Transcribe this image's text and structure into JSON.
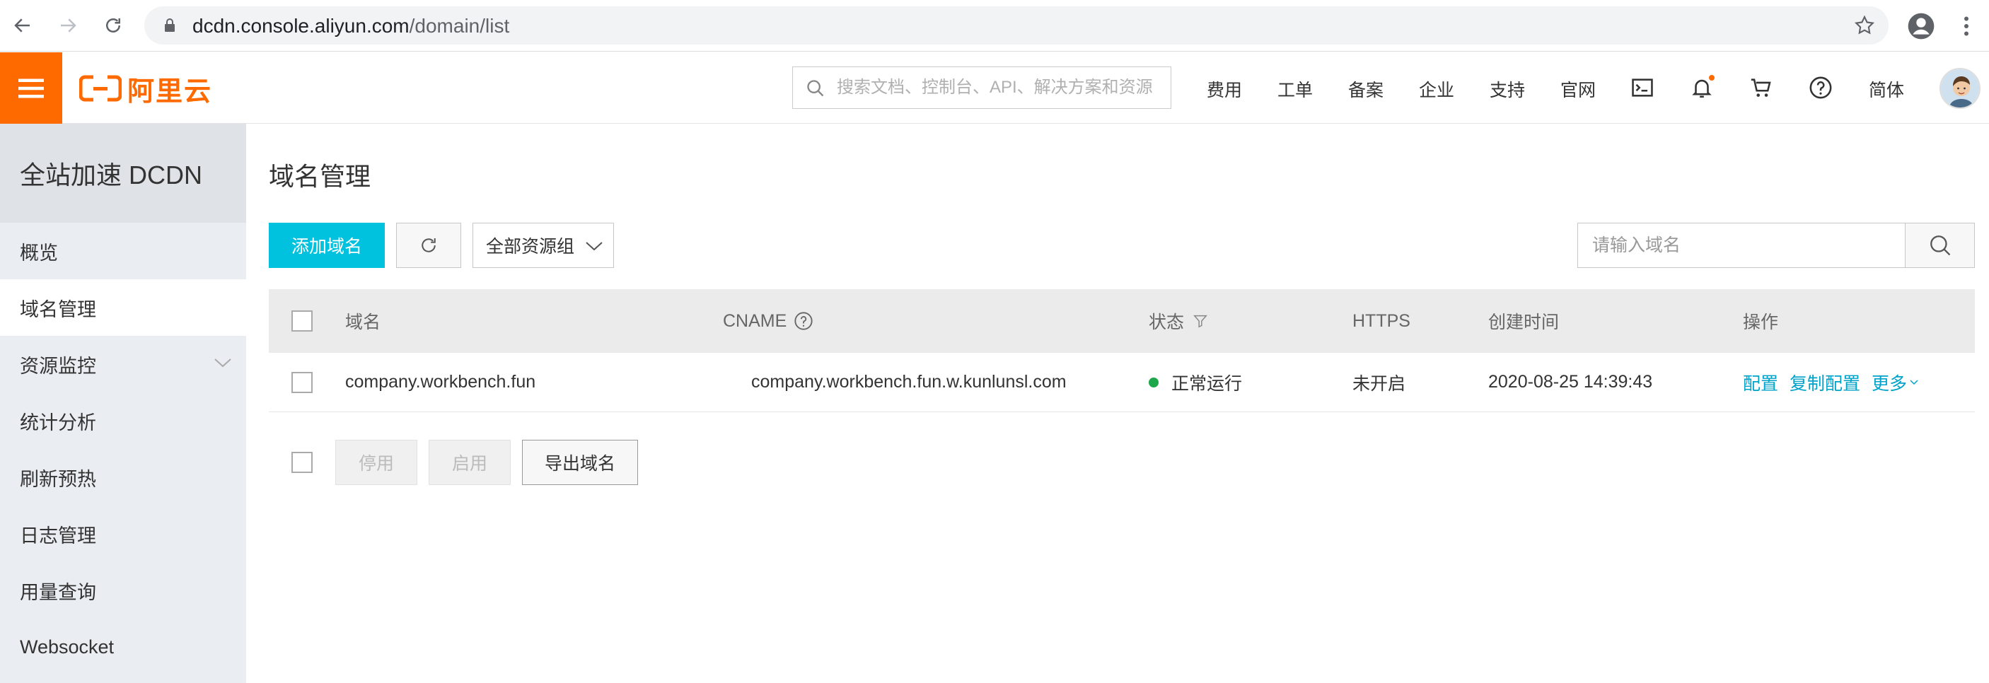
{
  "browser": {
    "url_host": "dcdn.console.aliyun.com",
    "url_path": "/domain/list"
  },
  "topbar": {
    "logo_text": "阿里云",
    "search_placeholder": "搜索文档、控制台、API、解决方案和资源",
    "links": [
      "费用",
      "工单",
      "备案",
      "企业",
      "支持",
      "官网"
    ],
    "language": "简体",
    "icons": [
      "terminal-icon",
      "bell-icon",
      "cart-icon",
      "help-icon"
    ],
    "accent": "#ff6a00"
  },
  "sidebar": {
    "title": "全站加速 DCDN",
    "items": [
      {
        "label": "概览"
      },
      {
        "label": "域名管理",
        "active": true
      },
      {
        "label": "资源监控",
        "expandable": true
      },
      {
        "label": "统计分析"
      },
      {
        "label": "刷新预热"
      },
      {
        "label": "日志管理"
      },
      {
        "label": "用量查询"
      },
      {
        "label": "Websocket"
      }
    ]
  },
  "main": {
    "title": "域名管理",
    "add_button": "添加域名",
    "resource_group": "全部资源组",
    "search_placeholder": "请输入域名",
    "table": {
      "headers": {
        "domain": "域名",
        "cname": "CNAME",
        "status": "状态",
        "https": "HTTPS",
        "created": "创建时间",
        "actions": "操作"
      },
      "rows": [
        {
          "domain": "company.workbench.fun",
          "cname": "company.workbench.fun.w.kunlunsl.com",
          "status": "正常运行",
          "status_color": "#1ea74a",
          "https": "未开启",
          "created": "2020-08-25 14:39:43",
          "action_config": "配置",
          "action_copy": "复制配置",
          "action_more": "更多"
        }
      ]
    },
    "footer": {
      "stop": "停用",
      "enable": "启用",
      "export": "导出域名"
    },
    "primary_color": "#00c1de",
    "link_color": "#00a2ca"
  }
}
